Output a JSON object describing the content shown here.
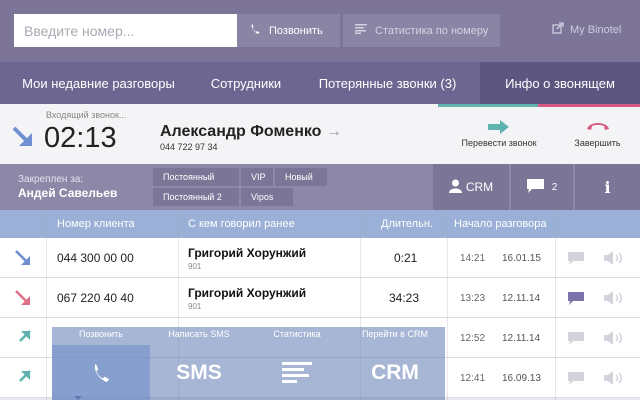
{
  "top": {
    "search_placeholder": "Введите номер...",
    "call_label": "Позвонить",
    "stats_label": "Статистика по номеру",
    "account_label": "My Binotel"
  },
  "tabs": [
    {
      "label": "Мои недавние разговоры"
    },
    {
      "label": "Сотрудники"
    },
    {
      "label": "Потерянные звонки (3)"
    },
    {
      "label": "Инфо о звонящем",
      "active": true
    }
  ],
  "call": {
    "status": "Входящий звонок...",
    "timer": "02:13",
    "caller_name": "Александр Фоменко",
    "caller_phone": "044 722 97 34",
    "transfer_label": "Перевести звонок",
    "end_label": "Завершить"
  },
  "pinned": {
    "label": "Закреплен за:",
    "name": "Андей Савельев",
    "tags": [
      "Постоянный",
      "VIP",
      "Новый",
      "Постоянный 2",
      "Vipos"
    ],
    "crm_label": "CRM",
    "messages_count": "2",
    "info_label": "i"
  },
  "table": {
    "headers": [
      "Номер клиента",
      "С кем говорил ранее",
      "Длительн.",
      "Начало разговора"
    ],
    "rows": [
      {
        "direction": "incoming",
        "number": "044 300 00 00",
        "name": "Григорий Хорунжий",
        "ext": "901",
        "duration": "0:21",
        "time": "14:21",
        "date": "16.01.15",
        "has_comment": false
      },
      {
        "direction": "missed",
        "number": "067 220 40 40",
        "name": "Григорий Хорунжий",
        "ext": "901",
        "duration": "34:23",
        "time": "13:23",
        "date": "12.11.14",
        "has_comment": true
      },
      {
        "direction": "outgoing",
        "number": "",
        "name": "",
        "ext": "",
        "duration": "",
        "time": "12:52",
        "date": "12.11.14",
        "has_comment": false
      },
      {
        "direction": "outgoing",
        "number": "",
        "name": "",
        "ext": "",
        "duration": "",
        "time": "12:41",
        "date": "16.09.13",
        "has_comment": false
      }
    ]
  },
  "actions": [
    {
      "label": "Позвонить",
      "icon": "phone-icon"
    },
    {
      "label": "Написать SMS",
      "text": "SMS"
    },
    {
      "label": "Статистика",
      "icon": "stats-icon"
    },
    {
      "label": "Перейти в CRM",
      "text": "CRM"
    }
  ],
  "colors": {
    "topbar": "#7c7598",
    "tabs": "#6d6690",
    "header": "#9bb0d6",
    "incoming": "#6f8fd0",
    "missed": "#e0708a",
    "outgoing": "#5fb3ad"
  }
}
